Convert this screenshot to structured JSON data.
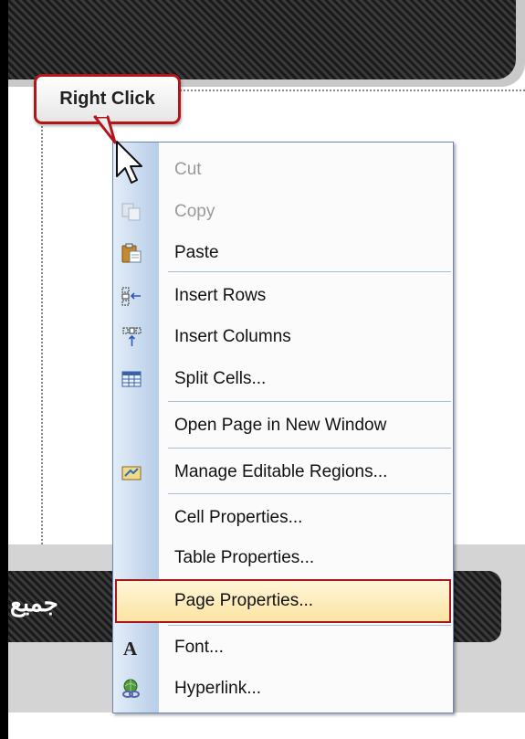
{
  "callout": {
    "text": "Right Click"
  },
  "footer": {
    "text": "جميع"
  },
  "menu": {
    "items": [
      {
        "label": "Cut",
        "icon": "cut-icon",
        "enabled": false
      },
      {
        "label": "Copy",
        "icon": "copy-icon",
        "enabled": false
      },
      {
        "label": "Paste",
        "icon": "paste-icon",
        "enabled": true
      },
      {
        "label": "Insert Rows",
        "icon": "insert-rows-icon",
        "enabled": true
      },
      {
        "label": "Insert Columns",
        "icon": "insert-columns-icon",
        "enabled": true
      },
      {
        "label": "Split Cells...",
        "icon": "split-cells-icon",
        "enabled": true
      },
      {
        "label": "Open Page in New Window",
        "icon": "",
        "enabled": true
      },
      {
        "label": "Manage Editable Regions...",
        "icon": "editable-regions-icon",
        "enabled": true
      },
      {
        "label": "Cell Properties...",
        "icon": "",
        "enabled": true
      },
      {
        "label": "Table Properties...",
        "icon": "",
        "enabled": true
      },
      {
        "label": "Page Properties...",
        "icon": "",
        "enabled": true,
        "highlighted": true
      },
      {
        "label": "Font...",
        "icon": "font-icon",
        "enabled": true
      },
      {
        "label": "Hyperlink...",
        "icon": "hyperlink-icon",
        "enabled": true
      }
    ]
  },
  "colors": {
    "highlight_border": "#a9171c",
    "callout_border": "#b3151a",
    "menu_border": "#6c8ab3"
  }
}
